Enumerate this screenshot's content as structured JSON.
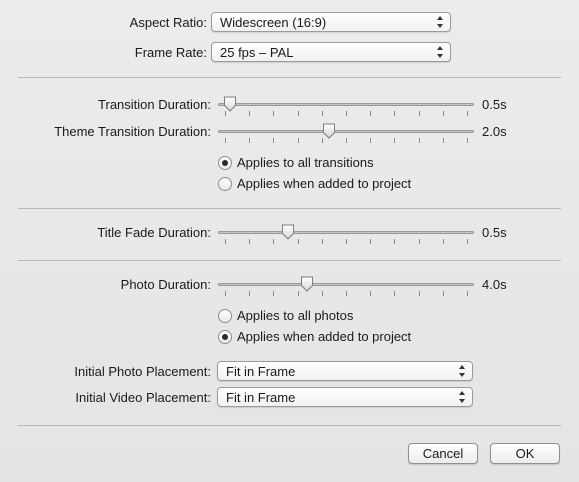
{
  "aspect_ratio": {
    "label": "Aspect Ratio:",
    "value": "Widescreen (16:9)"
  },
  "frame_rate": {
    "label": "Frame Rate:",
    "value": "25 fps – PAL"
  },
  "transition_duration": {
    "label": "Transition Duration:",
    "value": "0.5s",
    "level": 0.02
  },
  "theme_transition_duration": {
    "label": "Theme Transition Duration:",
    "value": "2.0s",
    "level": 0.43
  },
  "transition_apply": {
    "options": [
      "Applies to all transitions",
      "Applies when added to project"
    ],
    "selected": 0
  },
  "title_fade_duration": {
    "label": "Title Fade Duration:",
    "value": "0.5s",
    "level": 0.26
  },
  "photo_duration": {
    "label": "Photo Duration:",
    "value": "4.0s",
    "level": 0.34
  },
  "photo_apply": {
    "options": [
      "Applies to all photos",
      "Applies when added to project"
    ],
    "selected": 1
  },
  "initial_photo_placement": {
    "label": "Initial Photo Placement:",
    "value": "Fit in Frame"
  },
  "initial_video_placement": {
    "label": "Initial Video Placement:",
    "value": "Fit in Frame"
  },
  "buttons": {
    "cancel": "Cancel",
    "ok": "OK"
  },
  "colors": {
    "sheet": "#e8e8e8",
    "divider": "#b9b9b9",
    "track": "#c4c4c4"
  }
}
